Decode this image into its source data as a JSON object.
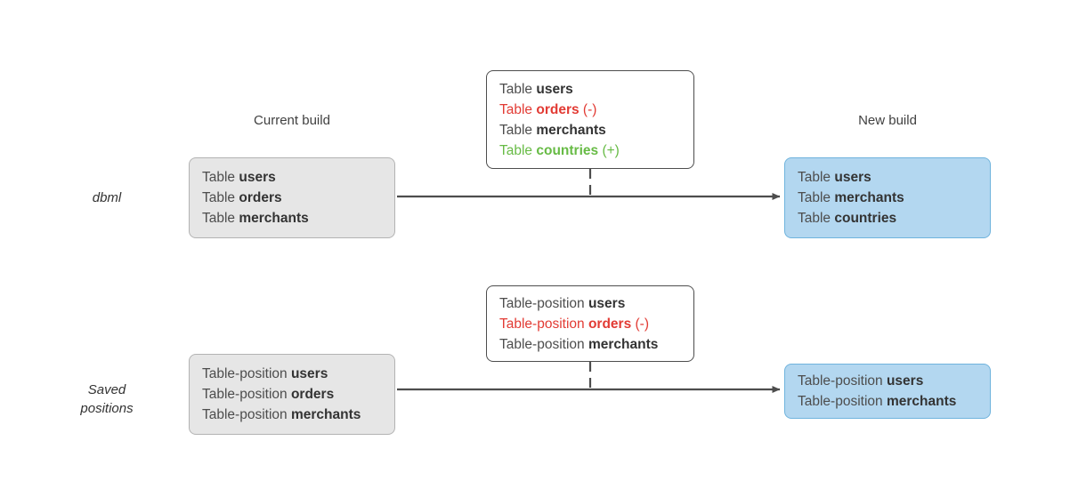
{
  "captions": {
    "current_build": "Current build",
    "new_build": "New build"
  },
  "row_labels": {
    "dbml": "dbml",
    "saved_positions_line1": "Saved",
    "saved_positions_line2": "positions"
  },
  "colors": {
    "removed": "#e23b34",
    "added": "#67bb45",
    "neutral_text": "#4d4d4d",
    "bold_text": "#333333",
    "grey_box_fill": "#e6e6e6",
    "grey_box_border": "#b3b3b3",
    "blue_box_fill": "#b3d7f0",
    "blue_box_border": "#6fb3dd",
    "white_box_border": "#4d4d4d",
    "connector": "#4d4d4d"
  },
  "dbml_row": {
    "current": {
      "lines": [
        {
          "prefix": "Table ",
          "name": "users",
          "suffix": "",
          "state": "neutral"
        },
        {
          "prefix": "Table ",
          "name": "orders",
          "suffix": "",
          "state": "neutral"
        },
        {
          "prefix": "Table ",
          "name": "merchants",
          "suffix": "",
          "state": "neutral"
        }
      ]
    },
    "diff": {
      "lines": [
        {
          "prefix": "Table ",
          "name": "users",
          "suffix": "",
          "state": "neutral"
        },
        {
          "prefix": "Table ",
          "name": "orders",
          "suffix": " (-)",
          "state": "removed"
        },
        {
          "prefix": "Table ",
          "name": "merchants",
          "suffix": "",
          "state": "neutral"
        },
        {
          "prefix": "Table ",
          "name": "countries",
          "suffix": " (+)",
          "state": "added"
        }
      ]
    },
    "new": {
      "lines": [
        {
          "prefix": "Table ",
          "name": "users",
          "suffix": "",
          "state": "neutral"
        },
        {
          "prefix": "Table ",
          "name": "merchants",
          "suffix": "",
          "state": "neutral"
        },
        {
          "prefix": "Table ",
          "name": "countries",
          "suffix": "",
          "state": "neutral"
        }
      ]
    }
  },
  "positions_row": {
    "current": {
      "lines": [
        {
          "prefix": "Table-position ",
          "name": "users",
          "suffix": "",
          "state": "neutral"
        },
        {
          "prefix": "Table-position ",
          "name": "orders",
          "suffix": "",
          "state": "neutral"
        },
        {
          "prefix": "Table-position ",
          "name": "merchants",
          "suffix": "",
          "state": "neutral"
        }
      ]
    },
    "diff": {
      "lines": [
        {
          "prefix": "Table-position ",
          "name": "users",
          "suffix": "",
          "state": "neutral"
        },
        {
          "prefix": "Table-position ",
          "name": "orders",
          "suffix": " (-)",
          "state": "removed"
        },
        {
          "prefix": "Table-position ",
          "name": "merchants",
          "suffix": "",
          "state": "neutral"
        }
      ]
    },
    "new": {
      "lines": [
        {
          "prefix": "Table-position ",
          "name": "users",
          "suffix": "",
          "state": "neutral"
        },
        {
          "prefix": "Table-position ",
          "name": "merchants",
          "suffix": "",
          "state": "neutral"
        }
      ]
    }
  }
}
